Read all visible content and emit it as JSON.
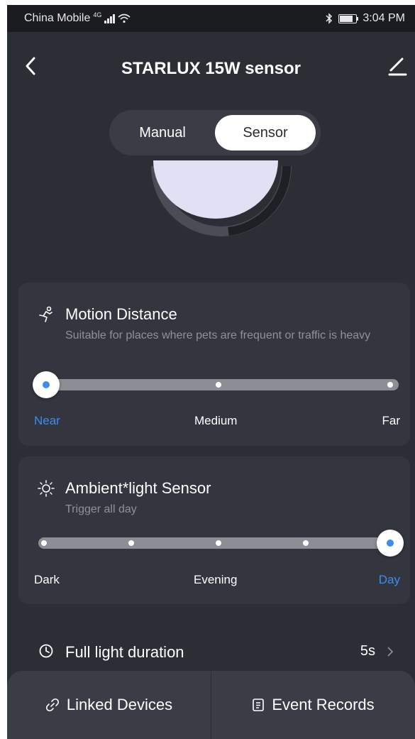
{
  "status_bar": {
    "carrier": "China Mobile",
    "network": "4G",
    "time": "3:04 PM"
  },
  "header": {
    "title": "STARLUX 15W sensor",
    "back_icon": "chevron-left-icon",
    "edit_icon": "pencil-icon"
  },
  "mode_toggle": {
    "options": [
      "Manual",
      "Sensor"
    ],
    "selected": "Sensor"
  },
  "motion_distance": {
    "icon": "running-person-icon",
    "title": "Motion Distance",
    "description": "Suitable for places where pets are frequent or traffic is heavy",
    "labels": [
      "Near",
      "Medium",
      "Far"
    ],
    "selected_index": 0,
    "stops": 3
  },
  "ambient_light": {
    "icon": "sun-icon",
    "title": "Ambient*light Sensor",
    "description": "Trigger all day",
    "labels": [
      "Dark",
      "Evening",
      "Day"
    ],
    "selected_index": 4,
    "stops": 5
  },
  "full_light_duration": {
    "icon": "clock-icon",
    "label": "Full light duration",
    "value": "5s"
  },
  "bottom_bar": {
    "linked_devices": "Linked Devices",
    "event_records": "Event Records"
  },
  "colors": {
    "background": "#2b2e35",
    "card": "#33363e",
    "accent": "#3d8cf0",
    "status_bar": "#1b1c20"
  }
}
